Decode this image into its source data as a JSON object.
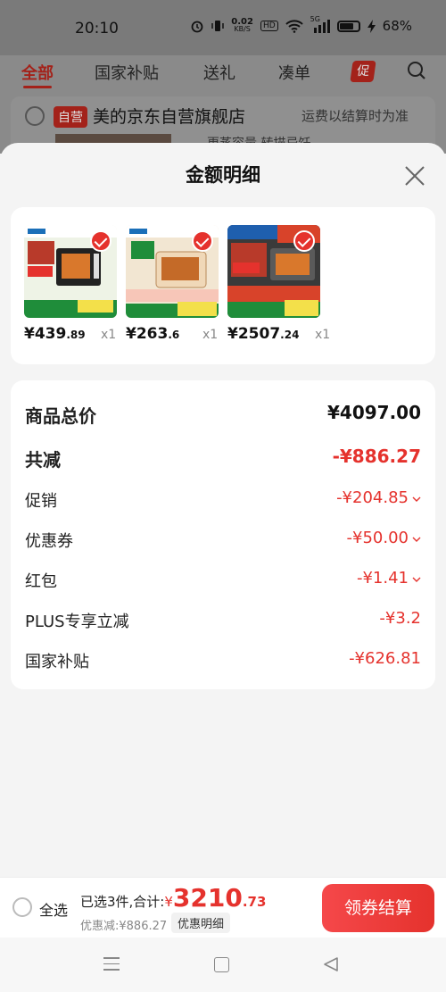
{
  "status_bar": {
    "time": "20:10",
    "speed_value": "0.02",
    "speed_unit": "KB/S",
    "hd": "HD",
    "net": "5G",
    "battery": "68%"
  },
  "background_page": {
    "tabs": [
      "全部",
      "国家补贴",
      "送礼",
      "凑单"
    ],
    "promo_badge": "促",
    "store_tag": "自营",
    "store_name": "美的京东自营旗舰店",
    "shipping_note": "运费以结算时为准",
    "store_subtitle": "更蒸容量 转描忌饪"
  },
  "sheet": {
    "title": "金额明细",
    "products": [
      {
        "price_int": "¥439",
        "price_dec": ".89",
        "qty": "x1"
      },
      {
        "price_int": "¥263",
        "price_dec": ".6",
        "qty": "x1"
      },
      {
        "price_int": "¥2507",
        "price_dec": ".24",
        "qty": "x1"
      }
    ],
    "summary": [
      {
        "label": "商品总价",
        "value": "¥4097.00"
      },
      {
        "label": "共减",
        "value": "-¥886.27"
      },
      {
        "label": "促销",
        "value": "-¥204.85"
      },
      {
        "label": "优惠券",
        "value": "-¥50.00"
      },
      {
        "label": "红包",
        "value": "-¥1.41"
      },
      {
        "label": "PLUS专享立减",
        "value": "-¥3.2"
      },
      {
        "label": "国家补贴",
        "value": "-¥626.81"
      }
    ]
  },
  "bottom_bar": {
    "select_all": "全选",
    "selected_text": "已选3件,合计:",
    "currency": "¥",
    "total_int": "3210",
    "total_dec": ".73",
    "saved": "优惠减:¥886.27",
    "detail_label": "优惠明细",
    "checkout": "领券结算"
  },
  "colors": {
    "accent_red": "#e5322d",
    "dim_red": "#a3221a"
  }
}
